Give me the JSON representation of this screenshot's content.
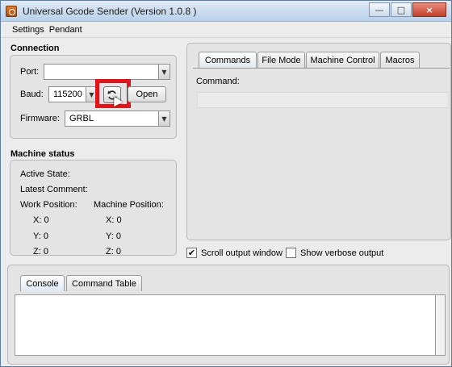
{
  "window": {
    "title": "Universal Gcode Sender (Version 1.0.8 )"
  },
  "window_controls": {
    "minimize": "—",
    "maximize": "□",
    "close": "×"
  },
  "menubar": {
    "items": [
      "Settings",
      "Pendant"
    ]
  },
  "connection": {
    "title": "Connection",
    "port_label": "Port:",
    "port_value": "",
    "baud_label": "Baud:",
    "baud_value": "115200",
    "refresh_icon": "refresh-icon",
    "open_label": "Open",
    "firmware_label": "Firmware:",
    "firmware_value": "GRBL"
  },
  "machine_status": {
    "title": "Machine status",
    "active_state_label": "Active State:",
    "latest_comment_label": "Latest Comment:",
    "work_position_label": "Work Position:",
    "machine_position_label": "Machine Position:",
    "work": {
      "x": "X:  0",
      "y": "Y:  0",
      "z": "Z:  0"
    },
    "machine": {
      "x": "X:  0",
      "y": "Y:  0",
      "z": "Z:  0"
    }
  },
  "right_tabs": {
    "tabs": [
      "Commands",
      "File Mode",
      "Machine Control",
      "Macros"
    ],
    "active": "Commands",
    "command_label": "Command:",
    "command_value": ""
  },
  "options": {
    "scroll_output_label": "Scroll output window",
    "scroll_output_checked": true,
    "verbose_label": "Show verbose output",
    "verbose_checked": false
  },
  "bottom_tabs": {
    "tabs": [
      "Console",
      "Command Table"
    ],
    "active": "Console"
  },
  "colors": {
    "highlight": "#e0141b",
    "titlebar": "#b9d1ea"
  }
}
